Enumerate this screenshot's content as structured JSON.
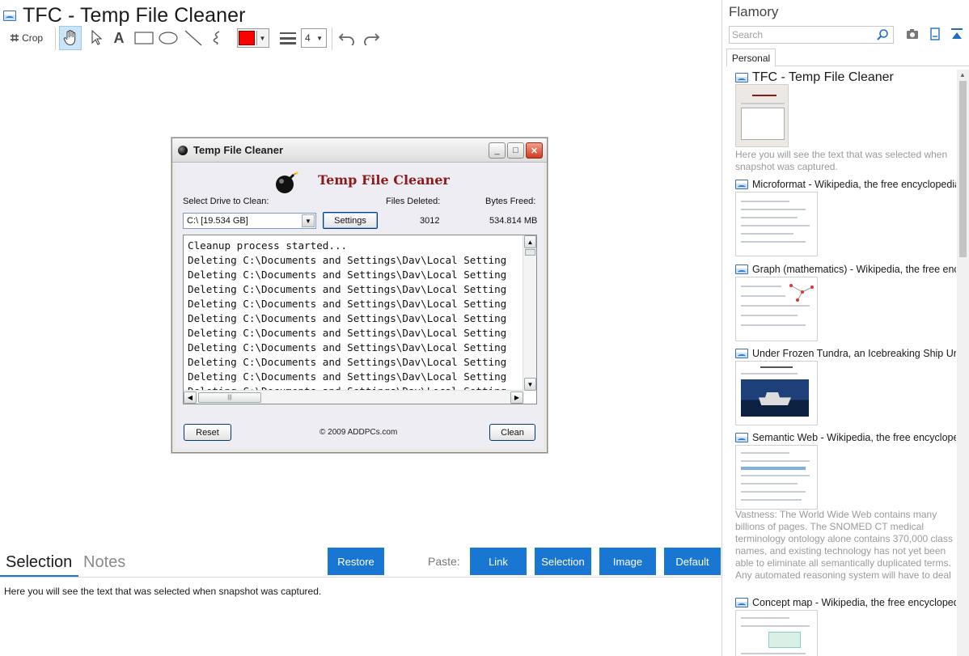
{
  "app": {
    "title": "TFC - Temp File Cleaner"
  },
  "toolbar": {
    "crop_label": "Crop",
    "line_size": "4",
    "pen_color": "#ff0000"
  },
  "snapshot": {
    "window_title": "Temp File Cleaner",
    "heading": "Temp File Cleaner",
    "select_drive_label": "Select Drive to Clean:",
    "files_deleted_label": "Files Deleted:",
    "bytes_freed_label": "Bytes Freed:",
    "drive_value": "C:\\ [19.534 GB]",
    "settings_label": "Settings",
    "files_deleted_value": "3012",
    "bytes_freed_value": "534.814 MB",
    "log_lines": [
      "Cleanup process started...",
      "Deleting C:\\Documents and Settings\\Dav\\Local Setting",
      "Deleting C:\\Documents and Settings\\Dav\\Local Setting",
      "Deleting C:\\Documents and Settings\\Dav\\Local Setting",
      "Deleting C:\\Documents and Settings\\Dav\\Local Setting",
      "Deleting C:\\Documents and Settings\\Dav\\Local Setting",
      "Deleting C:\\Documents and Settings\\Dav\\Local Setting",
      "Deleting C:\\Documents and Settings\\Dav\\Local Setting",
      "Deleting C:\\Documents and Settings\\Dav\\Local Setting",
      "Deleting C:\\Documents and Settings\\Dav\\Local Setting",
      "Deleting C:\\Documents and Settings\\Dav\\Local Setting",
      "Deleting C:\\Documents and Settings\\Dav\\Local Setting"
    ],
    "reset_label": "Reset",
    "copyright": "© 2009 ADDPCs.com",
    "clean_label": "Clean"
  },
  "bottom": {
    "tab_selection": "Selection",
    "tab_notes": "Notes",
    "restore_label": "Restore",
    "paste_label": "Paste:",
    "link_label": "Link",
    "selection_label": "Selection",
    "image_label": "Image",
    "default_label": "Default",
    "selection_text": "Here you will see the text that was selected when snapshot was captured."
  },
  "sidebar": {
    "title": "Flamory",
    "search_placeholder": "Search",
    "tab_personal": "Personal",
    "entries": [
      {
        "title": "TFC - Temp File Cleaner",
        "desc": "Here you will see the text that was selected when snapshot was captured."
      },
      {
        "title": "Microformat - Wikipedia, the free encyclopedia",
        "desc": ""
      },
      {
        "title": "Graph (mathematics) - Wikipedia, the free ency",
        "desc": ""
      },
      {
        "title": "Under Frozen Tundra, an Icebreaking Ship Unco",
        "desc": ""
      },
      {
        "title": "Semantic Web - Wikipedia, the free encycloped",
        "desc": "Vastness: The World Wide Web contains many billions of pages. The SNOMED CT medical terminology ontology alone contains 370,000 class names, and existing technology has not yet been able to eliminate all semantically duplicated terms. Any automated reasoning system will have to deal with truly huge inputs."
      },
      {
        "title": "Concept map - Wikipedia, the free encyclopedi",
        "desc": ""
      }
    ]
  },
  "colors": {
    "accent_blue": "#1976d2",
    "heading_red": "#8c1a1a"
  }
}
